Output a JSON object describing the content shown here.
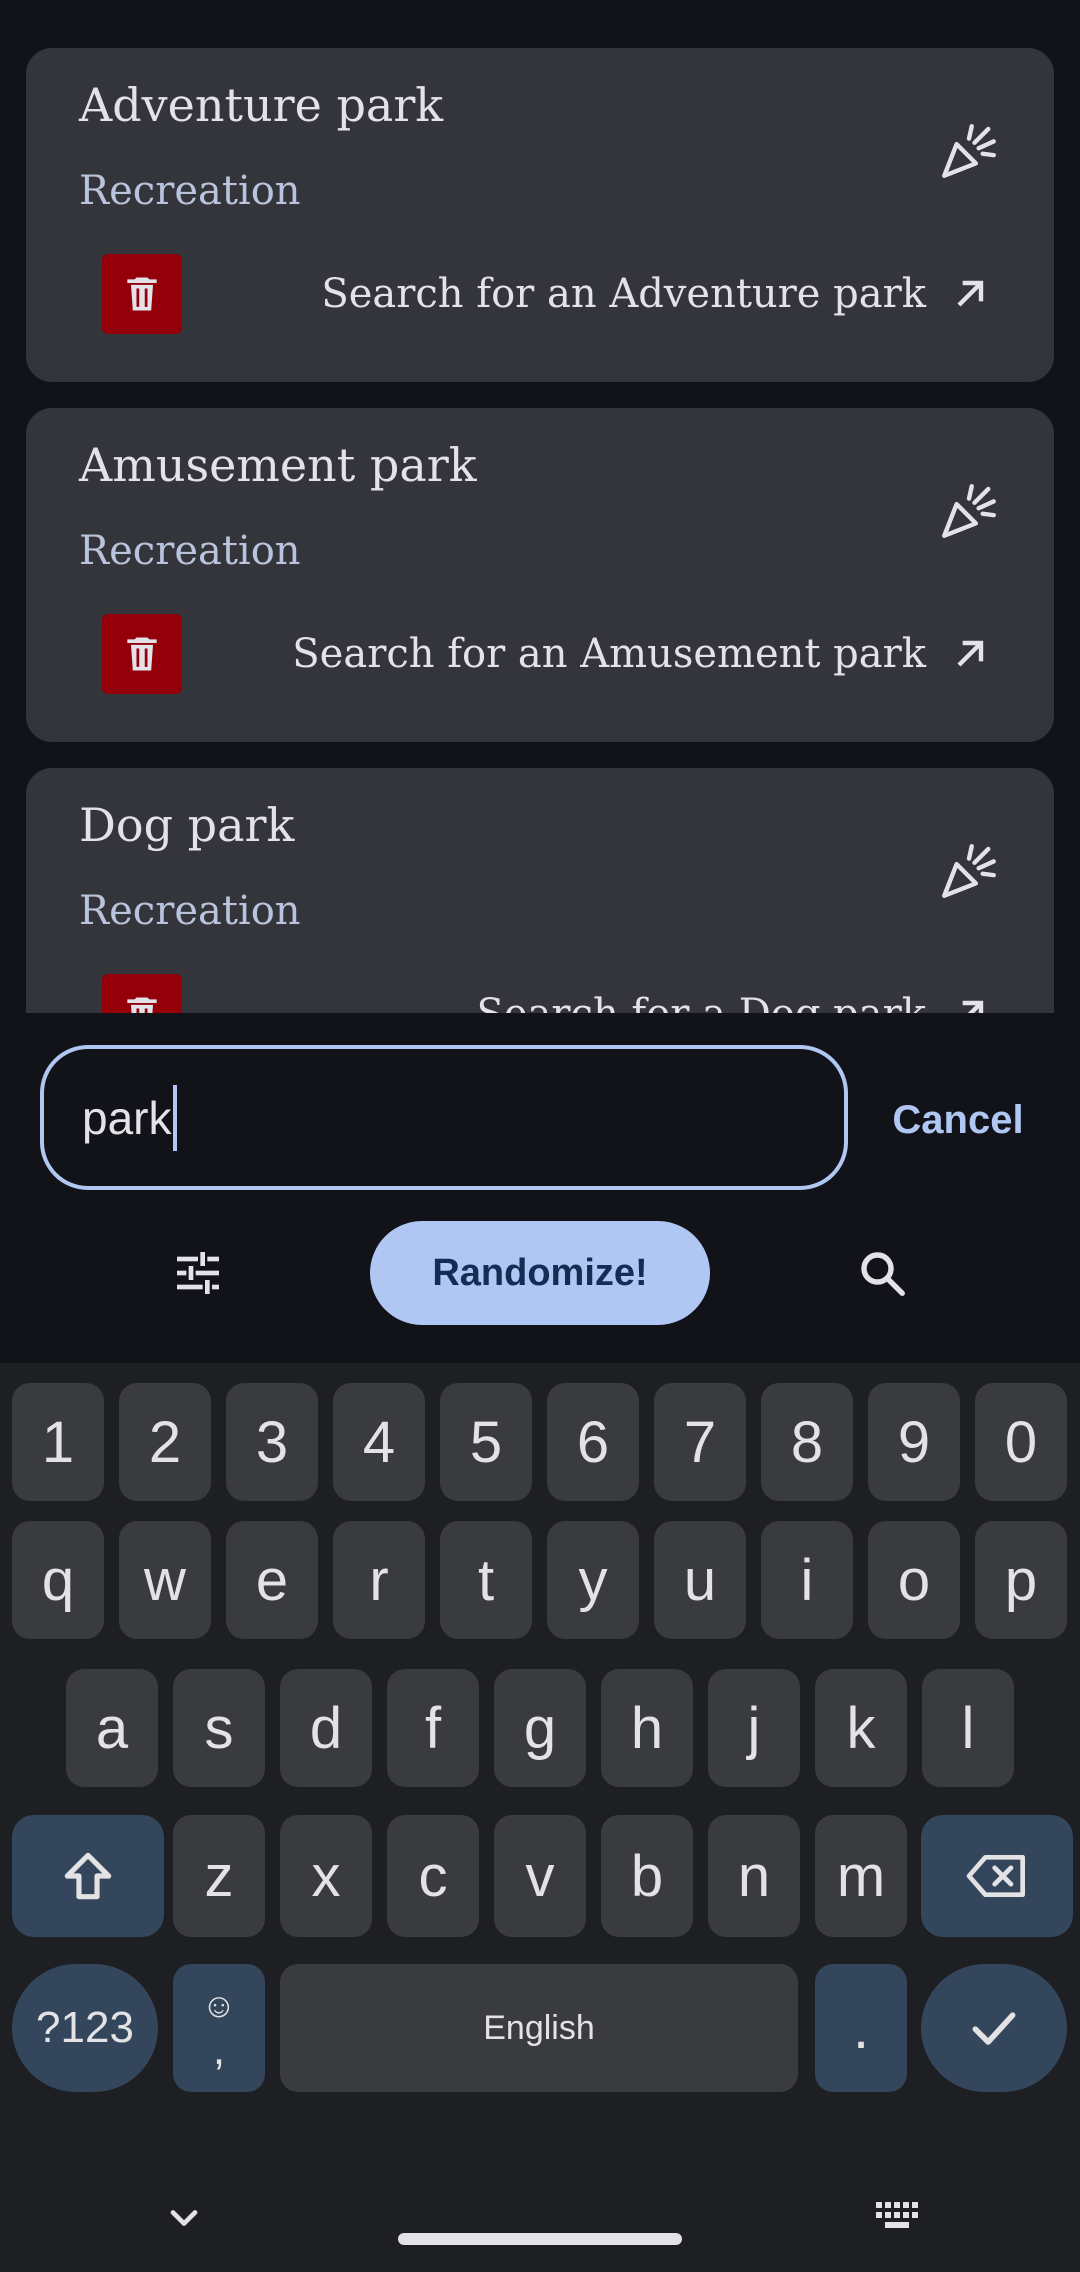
{
  "results": [
    {
      "title": "Adventure park",
      "category": "Recreation",
      "search_label": "Search for an Adventure park"
    },
    {
      "title": "Amusement park",
      "category": "Recreation",
      "search_label": "Search for an Amusement park"
    },
    {
      "title": "Dog park",
      "category": "Recreation",
      "search_label": "Search for a Dog park"
    }
  ],
  "search": {
    "value": "park",
    "cancel_label": "Cancel"
  },
  "actions": {
    "randomize_label": "Randomize!"
  },
  "keyboard": {
    "row_numbers": [
      "1",
      "2",
      "3",
      "4",
      "5",
      "6",
      "7",
      "8",
      "9",
      "0"
    ],
    "row_top": [
      "q",
      "w",
      "e",
      "r",
      "t",
      "y",
      "u",
      "i",
      "o",
      "p"
    ],
    "row_home": [
      "a",
      "s",
      "d",
      "f",
      "g",
      "h",
      "j",
      "k",
      "l"
    ],
    "row_bottom": [
      "z",
      "x",
      "c",
      "v",
      "b",
      "n",
      "m"
    ],
    "symbols_label": "?123",
    "emoji_label": "☺",
    "comma_label": ",",
    "space_label": "English",
    "period_label": "."
  },
  "colors": {
    "accent": "#b0c6f3",
    "card": "#33353b",
    "delete": "#93000a",
    "background": "#111318"
  }
}
